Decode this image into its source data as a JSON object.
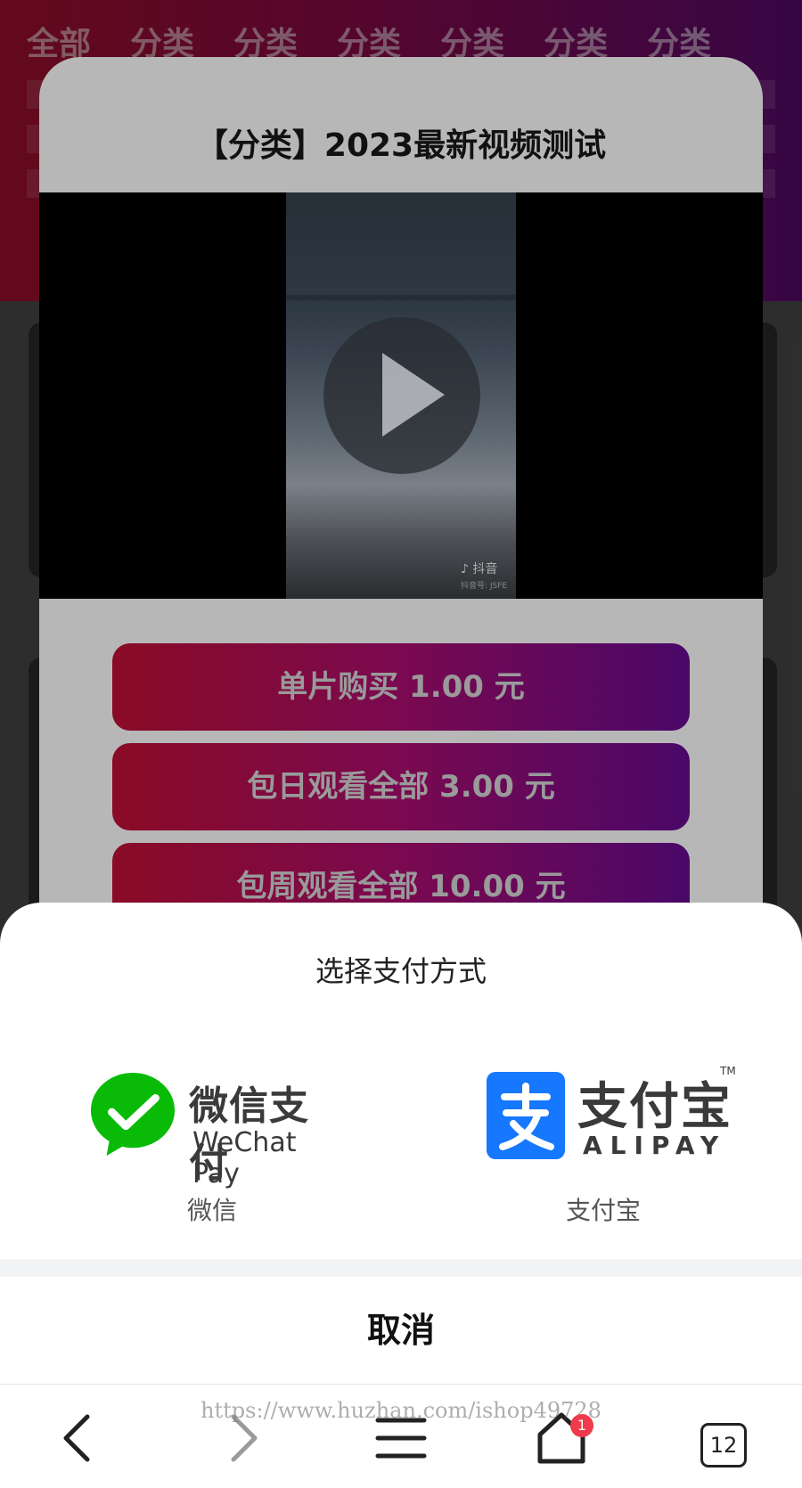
{
  "background_page": {
    "tabs": [
      "全部",
      "分类",
      "分类",
      "分类",
      "分类",
      "分类",
      "分类"
    ]
  },
  "video_modal": {
    "title": "【分类】2023最新视频测试",
    "video_watermark": "抖音",
    "video_watermark_sub": "抖音号: JSFE",
    "buttons": [
      {
        "label": "单片购买 1.00 元"
      },
      {
        "label": "包日观看全部 3.00 元"
      },
      {
        "label": "包周观看全部 10.00 元"
      }
    ]
  },
  "payment_sheet": {
    "title": "选择支付方式",
    "options": [
      {
        "logo_text": "微信支付",
        "logo_subtext": "WeChat Pay",
        "label": "微信",
        "icon": "wechat-pay-icon",
        "color": "#09bb07"
      },
      {
        "logo_text": "支付宝",
        "logo_tm": "TM",
        "logo_subtext": "ALIPAY",
        "label": "支付宝",
        "icon": "alipay-icon",
        "color": "#1677ff"
      }
    ],
    "cancel_label": "取消"
  },
  "browser_nav": {
    "watermark": "https://www.huzhan.com/ishop49728",
    "home_badge": "1",
    "tab_count": "12"
  }
}
